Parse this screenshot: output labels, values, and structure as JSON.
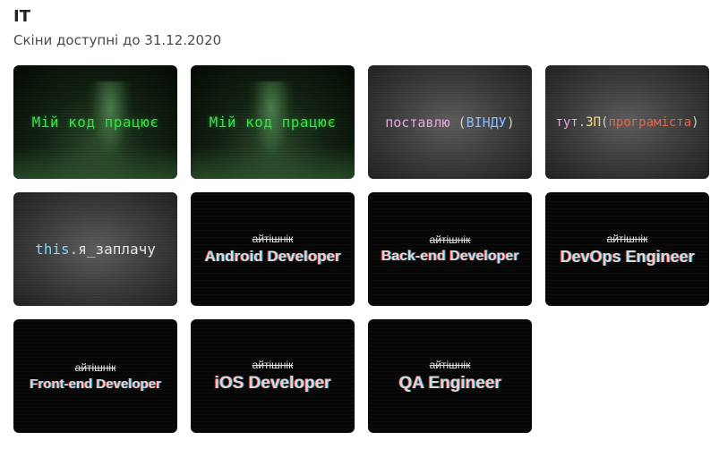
{
  "header": {
    "title": "IT",
    "subtitle": "Скіни доступні до 31.12.2020"
  },
  "skins": [
    {
      "text": "Мій код працює"
    },
    {
      "text": "Мій код працює"
    },
    {
      "parts": [
        "поставлю",
        " (",
        "ВІНДУ",
        ")"
      ]
    },
    {
      "parts": [
        "тут",
        ".",
        "ЗП",
        "(",
        "програміста",
        ")"
      ]
    },
    {
      "parts": [
        "this",
        ".",
        "я_заплачу"
      ]
    },
    {
      "strike": "айтішнік",
      "role": "Android Developer"
    },
    {
      "strike": "айтішнік",
      "role": "Back-end Developer"
    },
    {
      "strike": "айтішнік",
      "role": "DevOps Engineer"
    },
    {
      "strike": "айтішнік",
      "role": "Front-end Developer"
    },
    {
      "strike": "айтішнік",
      "role": "iOS Developer"
    },
    {
      "strike": "айтішнік",
      "role": "QA Engineer"
    }
  ],
  "colors": {
    "matrix_text": "#3ddc4a",
    "code_pink": "#e8a8e0",
    "code_blue": "#8fb8ff",
    "code_yellow": "#f0e08a",
    "code_orange": "#e0684a",
    "code_cyan": "#7fd4ff"
  }
}
